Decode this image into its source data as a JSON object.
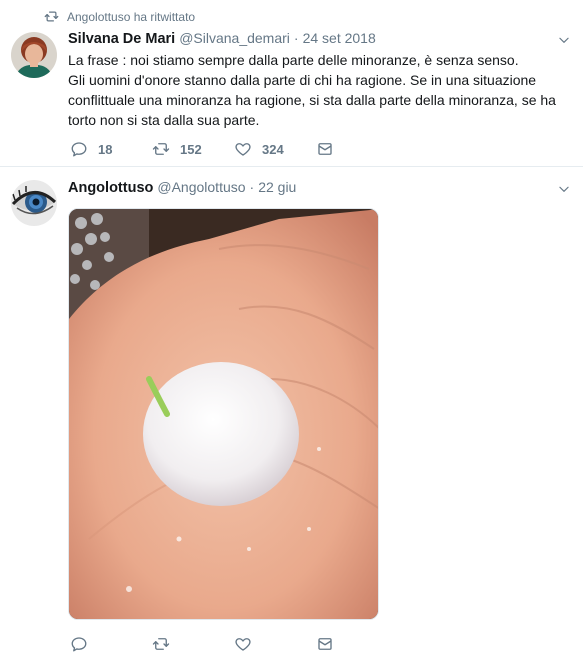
{
  "tweet1": {
    "retweet_notice": "Angolottuso ha ritwittato",
    "author_name": "Silvana De Mari",
    "author_handle": "@Silvana_demari",
    "separator": "·",
    "date": "24 set 2018",
    "text_line1": "La frase : noi stiamo sempre dalla parte delle minoranze, è senza senso.",
    "text_line2": "Gli uomini d'onore stanno dalla parte di chi ha ragione. Se in una situazione conflittuale una minoranza ha ragione, si sta dalla parte della minoranza, se ha torto non  si sta dalla sua parte.",
    "replies": "18",
    "retweets": "152",
    "likes": "324"
  },
  "tweet2": {
    "author_name": "Angolottuso",
    "author_handle": "@Angolottuso",
    "separator": "·",
    "date": "22 giu"
  },
  "icons": {
    "retweet_notice": "retweet-icon",
    "caret": "chevron-down-icon",
    "reply": "reply-icon",
    "retweet": "retweet-icon",
    "like": "heart-icon",
    "dm": "envelope-icon"
  },
  "colors": {
    "text": "#14171a",
    "muted": "#657786",
    "divider": "#e6ecf0"
  }
}
